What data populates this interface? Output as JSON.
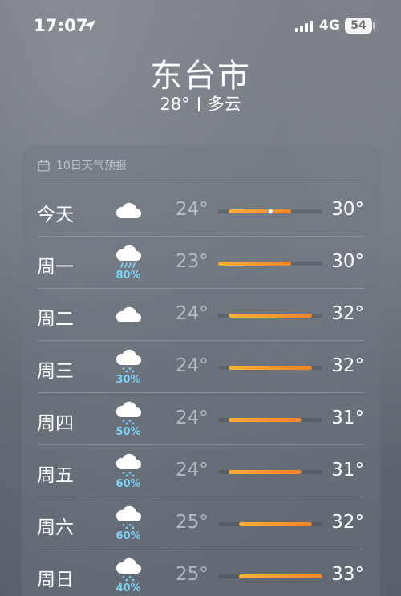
{
  "status_bar": {
    "time": "17:07",
    "network": "4G",
    "battery": "54"
  },
  "header": {
    "city": "东台市",
    "temperature": "28°",
    "condition": "多云"
  },
  "forecast": {
    "title": "10日天气预报",
    "range_min": 23,
    "range_max": 33,
    "current_temp": 28,
    "days": [
      {
        "day": "今天",
        "icon": "cloud-icon",
        "precip": "",
        "low": "24°",
        "high": "30°",
        "low_val": 24,
        "high_val": 30
      },
      {
        "day": "周一",
        "icon": "rain-icon",
        "precip": "80%",
        "low": "23°",
        "high": "30°",
        "low_val": 23,
        "high_val": 30
      },
      {
        "day": "周二",
        "icon": "cloud-icon",
        "precip": "",
        "low": "24°",
        "high": "32°",
        "low_val": 24,
        "high_val": 32
      },
      {
        "day": "周三",
        "icon": "drizzle-icon",
        "precip": "30%",
        "low": "24°",
        "high": "32°",
        "low_val": 24,
        "high_val": 32
      },
      {
        "day": "周四",
        "icon": "drizzle-icon",
        "precip": "50%",
        "low": "24°",
        "high": "31°",
        "low_val": 24,
        "high_val": 31
      },
      {
        "day": "周五",
        "icon": "drizzle-icon",
        "precip": "60%",
        "low": "24°",
        "high": "31°",
        "low_val": 24,
        "high_val": 31
      },
      {
        "day": "周六",
        "icon": "drizzle-icon",
        "precip": "60%",
        "low": "25°",
        "high": "32°",
        "low_val": 25,
        "high_val": 32
      },
      {
        "day": "周日",
        "icon": "drizzle-icon",
        "precip": "40%",
        "low": "25°",
        "high": "33°",
        "low_val": 25,
        "high_val": 33
      }
    ]
  },
  "colors": {
    "precip": "#7fd0f5",
    "bar_start": "#f6b13a",
    "bar_end": "#f2862b"
  }
}
